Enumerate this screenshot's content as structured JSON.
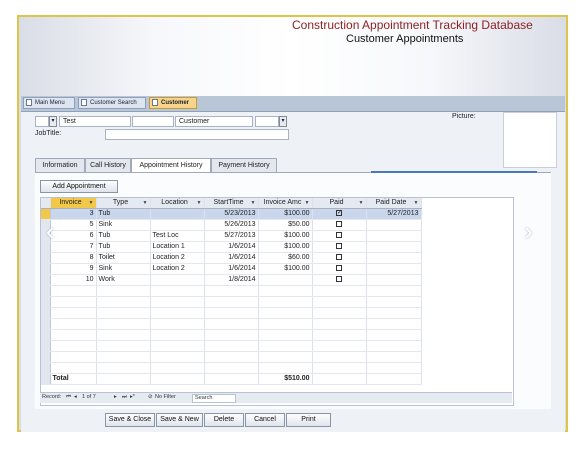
{
  "header": {
    "title": "Construction Appointment Tracking Database",
    "subtitle": "Customer Appointments"
  },
  "doc_tabs": [
    {
      "label": "Main Menu",
      "active": false
    },
    {
      "label": "Customer Search",
      "active": false
    },
    {
      "label": "Customer",
      "active": true
    }
  ],
  "form": {
    "first_name": "Test",
    "middle_name": "",
    "last_name": "Customer",
    "jobtitle_label": "JobTitle:",
    "jobtitle_value": "",
    "picture_label": "Picture:"
  },
  "form_tabs": [
    {
      "label": "Information",
      "active": false
    },
    {
      "label": "Call History",
      "active": false
    },
    {
      "label": "Appointment History",
      "active": true
    },
    {
      "label": "Payment History",
      "active": false
    }
  ],
  "add_button": "Add Appointment",
  "grid": {
    "columns": [
      "Invoice",
      "Type",
      "Location",
      "StartTime",
      "Invoice Amc",
      "Paid",
      "Paid Date"
    ],
    "rows": [
      {
        "invoice": "3",
        "type": "Tub",
        "location": "",
        "start": "5/23/2013",
        "amount": "$100.00",
        "paid": true,
        "paid_date": "5/27/2013",
        "current": true
      },
      {
        "invoice": "5",
        "type": "Sink",
        "location": "",
        "start": "5/26/2013",
        "amount": "$50.00",
        "paid": false,
        "paid_date": "",
        "current": false
      },
      {
        "invoice": "6",
        "type": "Tub",
        "location": "Test Loc",
        "start": "5/27/2013",
        "amount": "$100.00",
        "paid": false,
        "paid_date": "",
        "current": false
      },
      {
        "invoice": "7",
        "type": "Tub",
        "location": "Location 1",
        "start": "1/6/2014",
        "amount": "$100.00",
        "paid": false,
        "paid_date": "",
        "current": false
      },
      {
        "invoice": "8",
        "type": "Toilet",
        "location": "Location 2",
        "start": "1/6/2014",
        "amount": "$60.00",
        "paid": false,
        "paid_date": "",
        "current": false
      },
      {
        "invoice": "9",
        "type": "Sink",
        "location": "Location 2",
        "start": "1/6/2014",
        "amount": "$100.00",
        "paid": false,
        "paid_date": "",
        "current": false
      },
      {
        "invoice": "10",
        "type": "Work",
        "location": "",
        "start": "1/8/2014",
        "amount": "",
        "paid": false,
        "paid_date": "",
        "current": false
      }
    ],
    "total_label": "Total",
    "total_amount": "$510.00"
  },
  "record_nav": {
    "label": "Record:",
    "position": "1 of 7",
    "filter": "No Filter",
    "search_placeholder": "Search"
  },
  "buttons": {
    "save_close": "Save & Close",
    "save_new": "Save & New",
    "delete": "Delete",
    "cancel": "Cancel",
    "print": "Print"
  },
  "icons": {
    "prev": "chevron-left-icon",
    "next": "chevron-right-icon"
  },
  "colors": {
    "title": "#8b1f1f",
    "frame_border": "#e0c44a",
    "active_tab": "#f7d48a",
    "selected_row": "#c9d6ec"
  }
}
